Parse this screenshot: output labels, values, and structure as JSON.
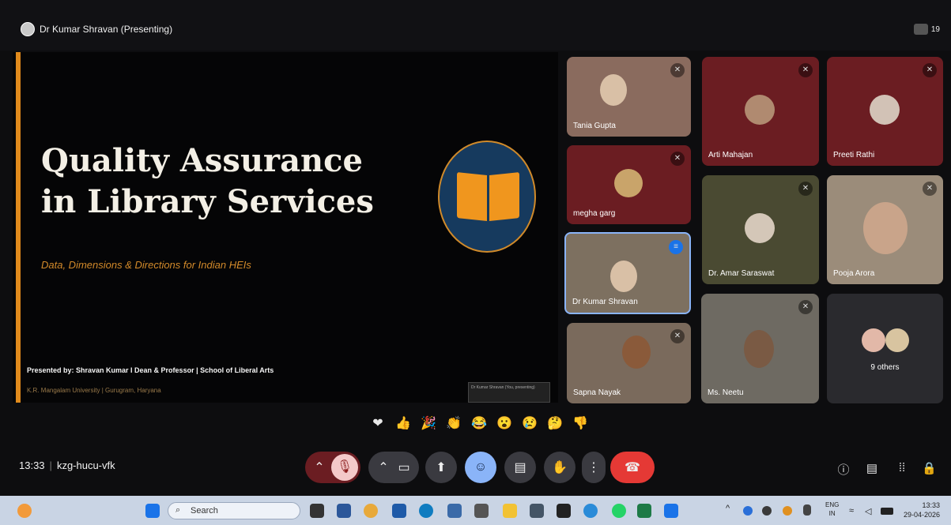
{
  "meeting": {
    "presenter_label": "Dr Kumar Shravan (Presenting)",
    "participant_count": "19",
    "time": "13:33",
    "code": "kzg-hucu-vfk"
  },
  "slide": {
    "title_line1": "Quality Assurance",
    "title_line2": "in Library Services",
    "subtitle": "Data, Dimensions & Directions for Indian HEIs",
    "presented_by": "Presented by: Shravan Kumar I Dean & Professor | School of Liberal Arts",
    "university": "K.R. Mangalam University | Gurugram, Haryana",
    "mini_preview": "Dr Kumar Shravan (You, presenting)"
  },
  "participants": [
    {
      "name": "Tania Gupta"
    },
    {
      "name": "megha garg"
    },
    {
      "name": "Dr Kumar Shravan"
    },
    {
      "name": "Sapna Nayak"
    },
    {
      "name": "Arti Mahajan"
    },
    {
      "name": "Preeti Rathi"
    },
    {
      "name": "Dr. Amar Saraswat"
    },
    {
      "name": "Pooja Arora"
    },
    {
      "name": "Ms. Neetu"
    },
    {
      "name": "9 others"
    }
  ],
  "reactions": [
    "❤",
    "👍",
    "🎉",
    "👏",
    "😂",
    "😮",
    "😢",
    "🤔",
    "👎"
  ],
  "taskbar": {
    "search_placeholder": "Search",
    "lang_line1": "ENG",
    "lang_line2": "IN",
    "clock_time": "13:33",
    "clock_date": "29-04-2026"
  },
  "colors": {
    "slide_accent": "#e08a1c",
    "end_call": "#e53935",
    "tile_maroon": "#6b1d22",
    "tile_olive": "#4a4a32"
  }
}
